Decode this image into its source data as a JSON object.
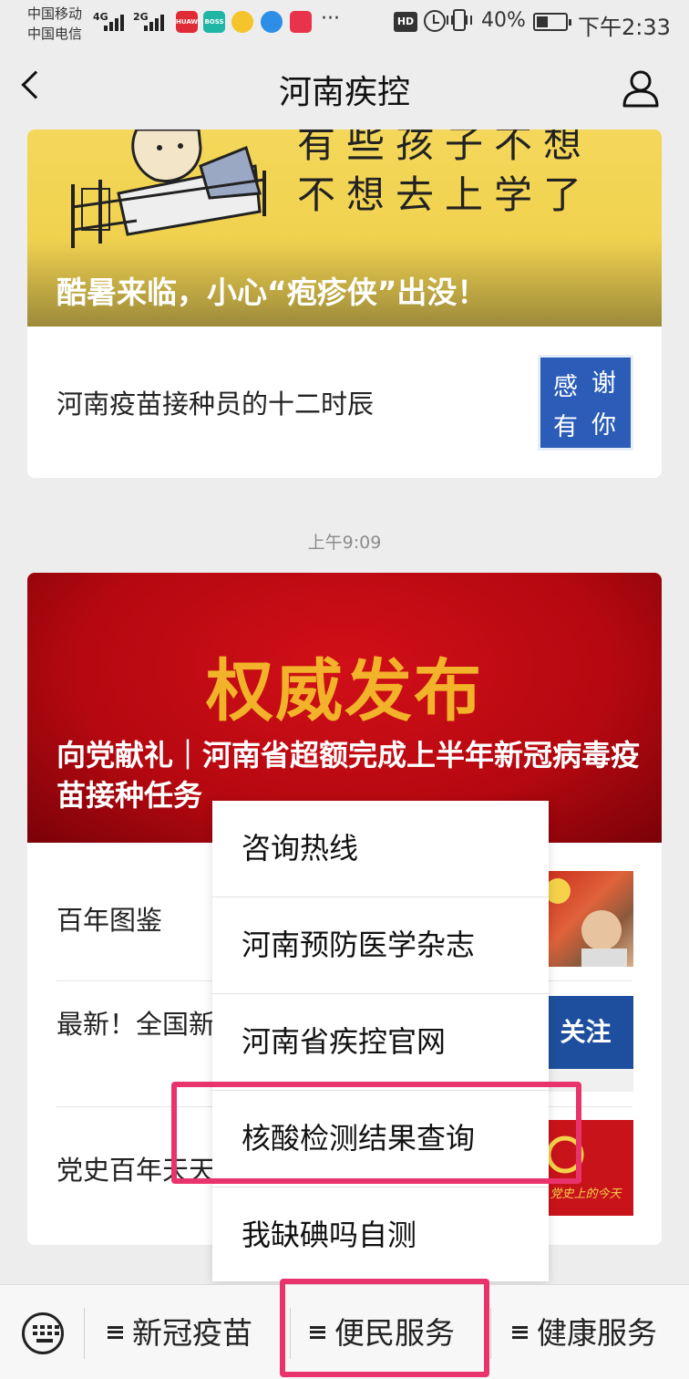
{
  "status_bar": {
    "carrier_1": "中国移动",
    "carrier_2": "中国电信",
    "network_1": "4G",
    "network_2": "2G",
    "app_icons": [
      "huawei-icon",
      "boss-zhipin-icon",
      "qq-browser-icon",
      "browser-icon",
      "reader-icon"
    ],
    "overflow": "···",
    "hd_label": "HD",
    "battery_percent": "40%",
    "battery_level": 0.4,
    "time": "下午2:33"
  },
  "header": {
    "title": "河南疾控"
  },
  "feed": {
    "card1": {
      "banner_text_top": "有些孩子不想",
      "banner_text_bottom": "不想去上学了",
      "banner_headline": "酷暑来临，小心“疱疹侠”出没！",
      "item_title": "河南疫苗接种员的十二时辰",
      "thumb_chars": [
        "感",
        "谢",
        "有",
        "你"
      ]
    },
    "timestamp": "上午9:09",
    "card2": {
      "banner_big": "权威发布",
      "banner_headline": "向党献礼｜河南省超额完成上半年新冠病毒疫苗接种任务",
      "items": [
        {
          "title": "百年图鉴"
        },
        {
          "title": "最新！全国新增境外输入",
          "thumb_text": "关注"
        },
        {
          "title": "党史百年天天读",
          "thumb_text": "党史上的今天"
        }
      ]
    }
  },
  "popup_menu": {
    "items": [
      "咨询热线",
      "河南预防医学杂志",
      "河南省疾控官网",
      "核酸检测结果查询",
      "我缺碘吗自测"
    ]
  },
  "bottom_bar": {
    "tabs": [
      "新冠疫苗",
      "便民服务",
      "健康服务"
    ]
  },
  "colors": {
    "highlight": "#e8336d",
    "banner_yellow": "#f4d75a",
    "banner_red": "#c20a12",
    "banner_gold": "#f2b229"
  }
}
